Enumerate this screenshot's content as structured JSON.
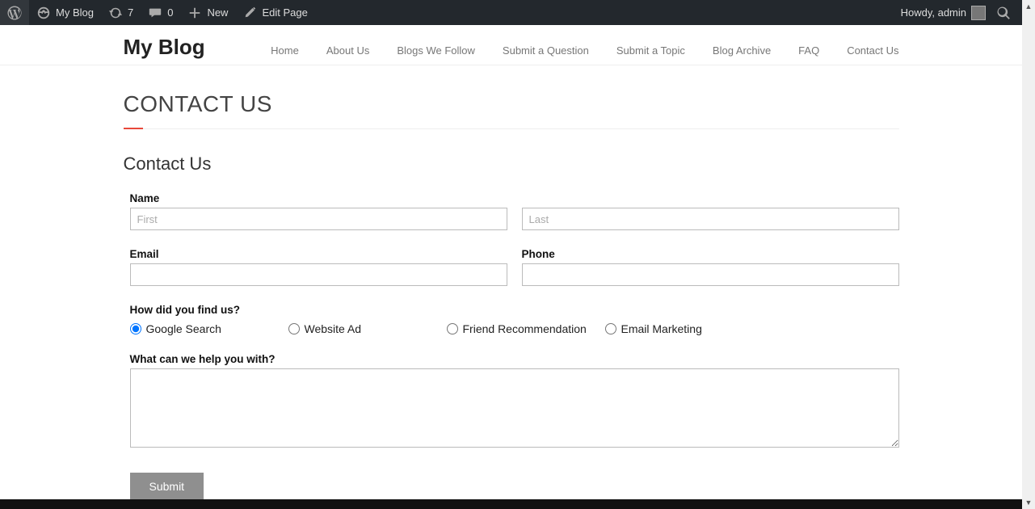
{
  "adminbar": {
    "site_name": "My Blog",
    "updates_count": "7",
    "comments_count": "0",
    "new_label": "New",
    "edit_label": "Edit Page",
    "howdy": "Howdy, admin"
  },
  "header": {
    "site_title": "My Blog",
    "nav": [
      "Home",
      "About Us",
      "Blogs We Follow",
      "Submit a Question",
      "Submit a Topic",
      "Blog Archive",
      "FAQ",
      "Contact Us"
    ]
  },
  "page": {
    "title": "CONTACT US",
    "form_title": "Contact Us",
    "labels": {
      "name": "Name",
      "email": "Email",
      "phone": "Phone",
      "find": "How did you find us?",
      "help": "What can we help you with?"
    },
    "placeholders": {
      "first": "First",
      "last": "Last"
    },
    "radios": [
      "Google Search",
      "Website Ad",
      "Friend Recommendation",
      "Email Marketing"
    ],
    "submit": "Submit"
  }
}
